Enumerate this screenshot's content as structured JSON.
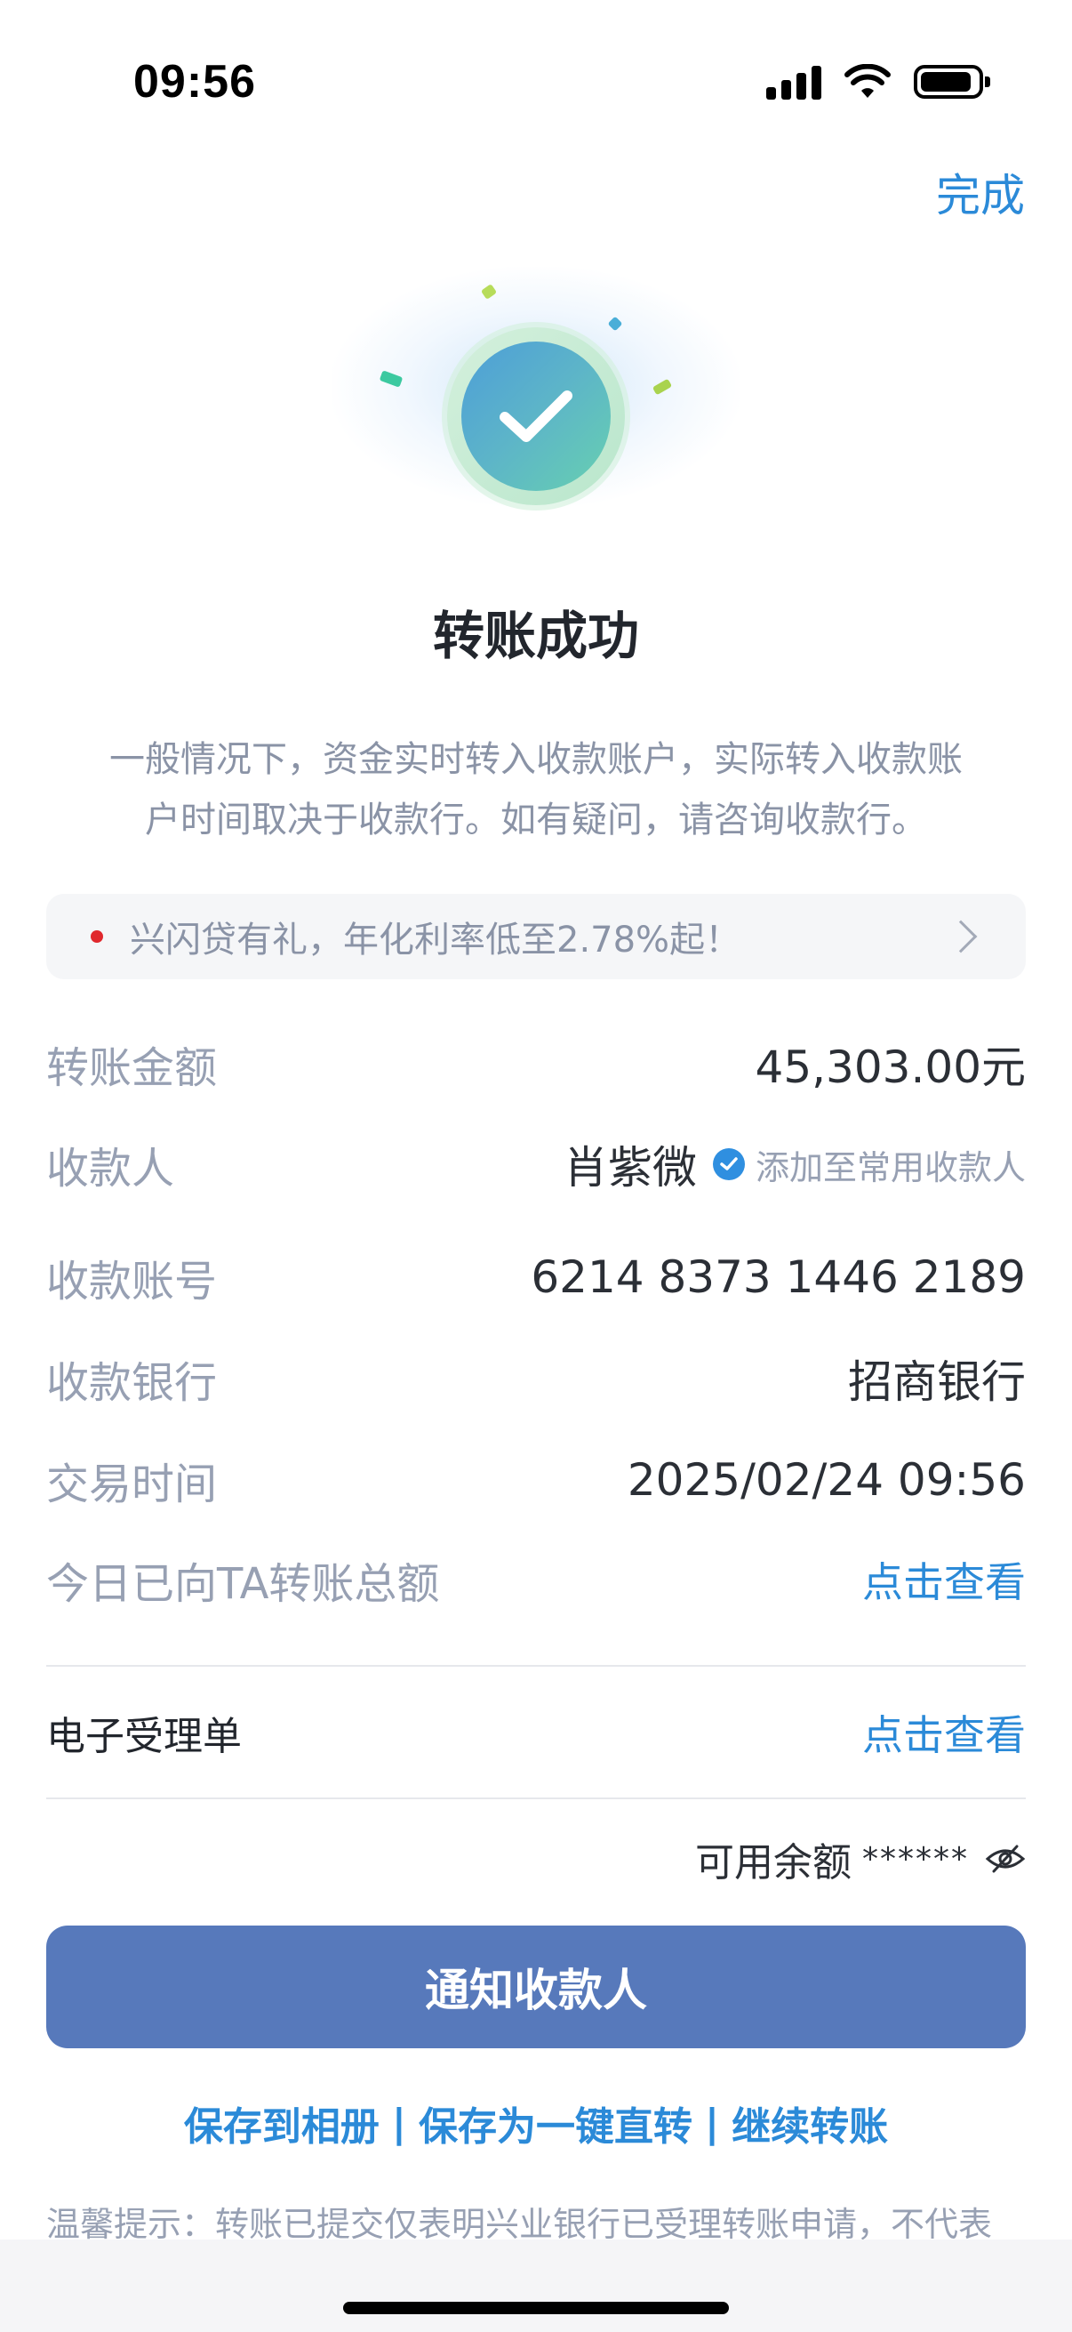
{
  "status_bar": {
    "time": "09:56"
  },
  "header": {
    "done_label": "完成"
  },
  "result": {
    "title": "转账成功",
    "notice_line1": "一般情况下，资金实时转入收款账户，实际转入收款账",
    "notice_line2": "户时间取决于收款行。如有疑问，请咨询收款行。"
  },
  "promo": {
    "text": "兴闪贷有礼，年化利率低至2.78%起！"
  },
  "details": {
    "amount_label": "转账金额",
    "amount_value": "45,303.00元",
    "payee_label": "收款人",
    "payee_name": "肖紫微",
    "add_payee_label": "添加至常用收款人",
    "account_label": "收款账号",
    "account_value": "6214 8373 1446 2189",
    "bank_label": "收款银行",
    "bank_value": "招商银行",
    "time_label": "交易时间",
    "time_value": "2025/02/24 09:56",
    "today_total_label": "今日已向TA转账总额",
    "today_total_link": "点击查看"
  },
  "receipt": {
    "label": "电子受理单",
    "link": "点击查看"
  },
  "balance": {
    "label": "可用余额",
    "masked": "******"
  },
  "notify_button": "通知收款人",
  "actions": {
    "save_album": "保存到相册",
    "save_quick": "保存为一键直转",
    "continue": "继续转账",
    "separator": "|"
  },
  "tip": "温馨提示：转账已提交仅表明兴业银行已受理转账申请，不代表",
  "colors": {
    "accent": "#2b8ad8",
    "button": "#5779bb",
    "promo_dot": "#e0282d"
  }
}
